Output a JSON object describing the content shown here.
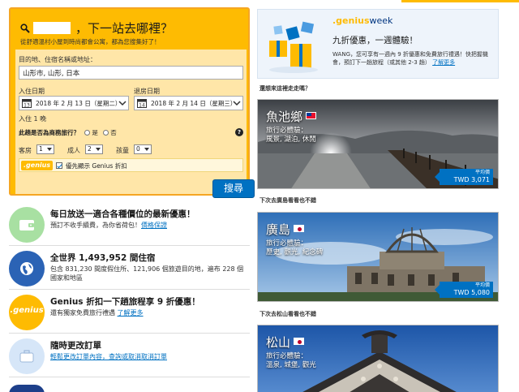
{
  "search": {
    "title": "，下一站去哪裡？",
    "subtitle": "從舒適溫村小屋到時尚都會公寓，都為您搜集好了！",
    "destination_label": "目的地、住宿名稱或地址：",
    "destination_value": "山形市, 山形, 日本",
    "checkin_label": "入住日期",
    "checkin_value": "2018 年 2 月 13 日（星期二）",
    "checkout_label": "退房日期",
    "checkout_value": "2018 年 2 月 14 日（星期三）",
    "nights": "入住 1 晚",
    "business_question": "此趟是否為商務旅行？",
    "yes": "是",
    "no": "否",
    "rooms_label": "客房",
    "rooms_value": "1",
    "adults_label": "成人",
    "adults_value": "2",
    "children_label": "孩童",
    "children_value": "0",
    "genius_badge": ".genius",
    "genius_checkbox_label": "優先顯示 Genius 折扣",
    "search_button": "搜尋",
    "help_icon": "?"
  },
  "features": [
    {
      "title": "每日放送一適合各種價位的最新優惠！",
      "desc": "預訂不收手續費，為你省荷包！",
      "link": "價格保證",
      "icon": "wallet-icon",
      "color": "#a8e0a2"
    },
    {
      "title": "全世界 1,493,952 間住宿",
      "desc": "包含 831,230 間度假住所、121,906 個旅遊目的地，遍布 228 個國家和地區",
      "link": "",
      "icon": "globe-icon",
      "color": "#2b63b5"
    },
    {
      "title": "Genius 折扣一下趟旅程享 9 折優惠！",
      "desc": "還有獨家免費旅行禮遇",
      "link": "了解更多",
      "icon": "genius-icon",
      "color": "#febb02",
      "circle_text": ".genius"
    },
    {
      "title": "隨時更改訂單",
      "desc": "",
      "link": "輕鬆更改訂單內容，查詢或取消取消訂單",
      "icon": "suitcase-icon",
      "color": "#d6e6f8"
    }
  ],
  "promo": {
    "brand_genius": ".genius",
    "brand_week": "week",
    "title": "九折優惠，一週體驗！",
    "desc": "WANG，您可享有一週內 9 折優惠和免費旅行禮遇！快把握機會，預訂下一趟旅程（或其他 2-3 趟）",
    "link": "了解更多"
  },
  "destinations": [
    {
      "label": "還想來這裡走走嗎？",
      "name": "魚池鄉",
      "sub1": "旅行必體驗：",
      "sub2": "風景, 湖泊, 休閒",
      "price_label": "平均價",
      "price": "TWD 3,071",
      "flag": "taiwan-flag-icon"
    },
    {
      "label": "下次去廣島看看也不錯",
      "name": "廣島",
      "sub1": "旅行必體驗：",
      "sub2": "歷史, 觀光, 紀念碑",
      "price_label": "平均價",
      "price": "TWD 5,080",
      "flag": "japan-flag-icon"
    },
    {
      "label": "下次去松山看看也不錯",
      "name": "松山",
      "sub1": "旅行必體驗：",
      "sub2": "溫泉, 城堡, 觀光",
      "price_label": "",
      "price": "",
      "flag": "japan-flag-icon"
    }
  ],
  "colors": {
    "accent": "#febb02",
    "brand_blue": "#0071c2",
    "dark_blue": "#003580"
  }
}
